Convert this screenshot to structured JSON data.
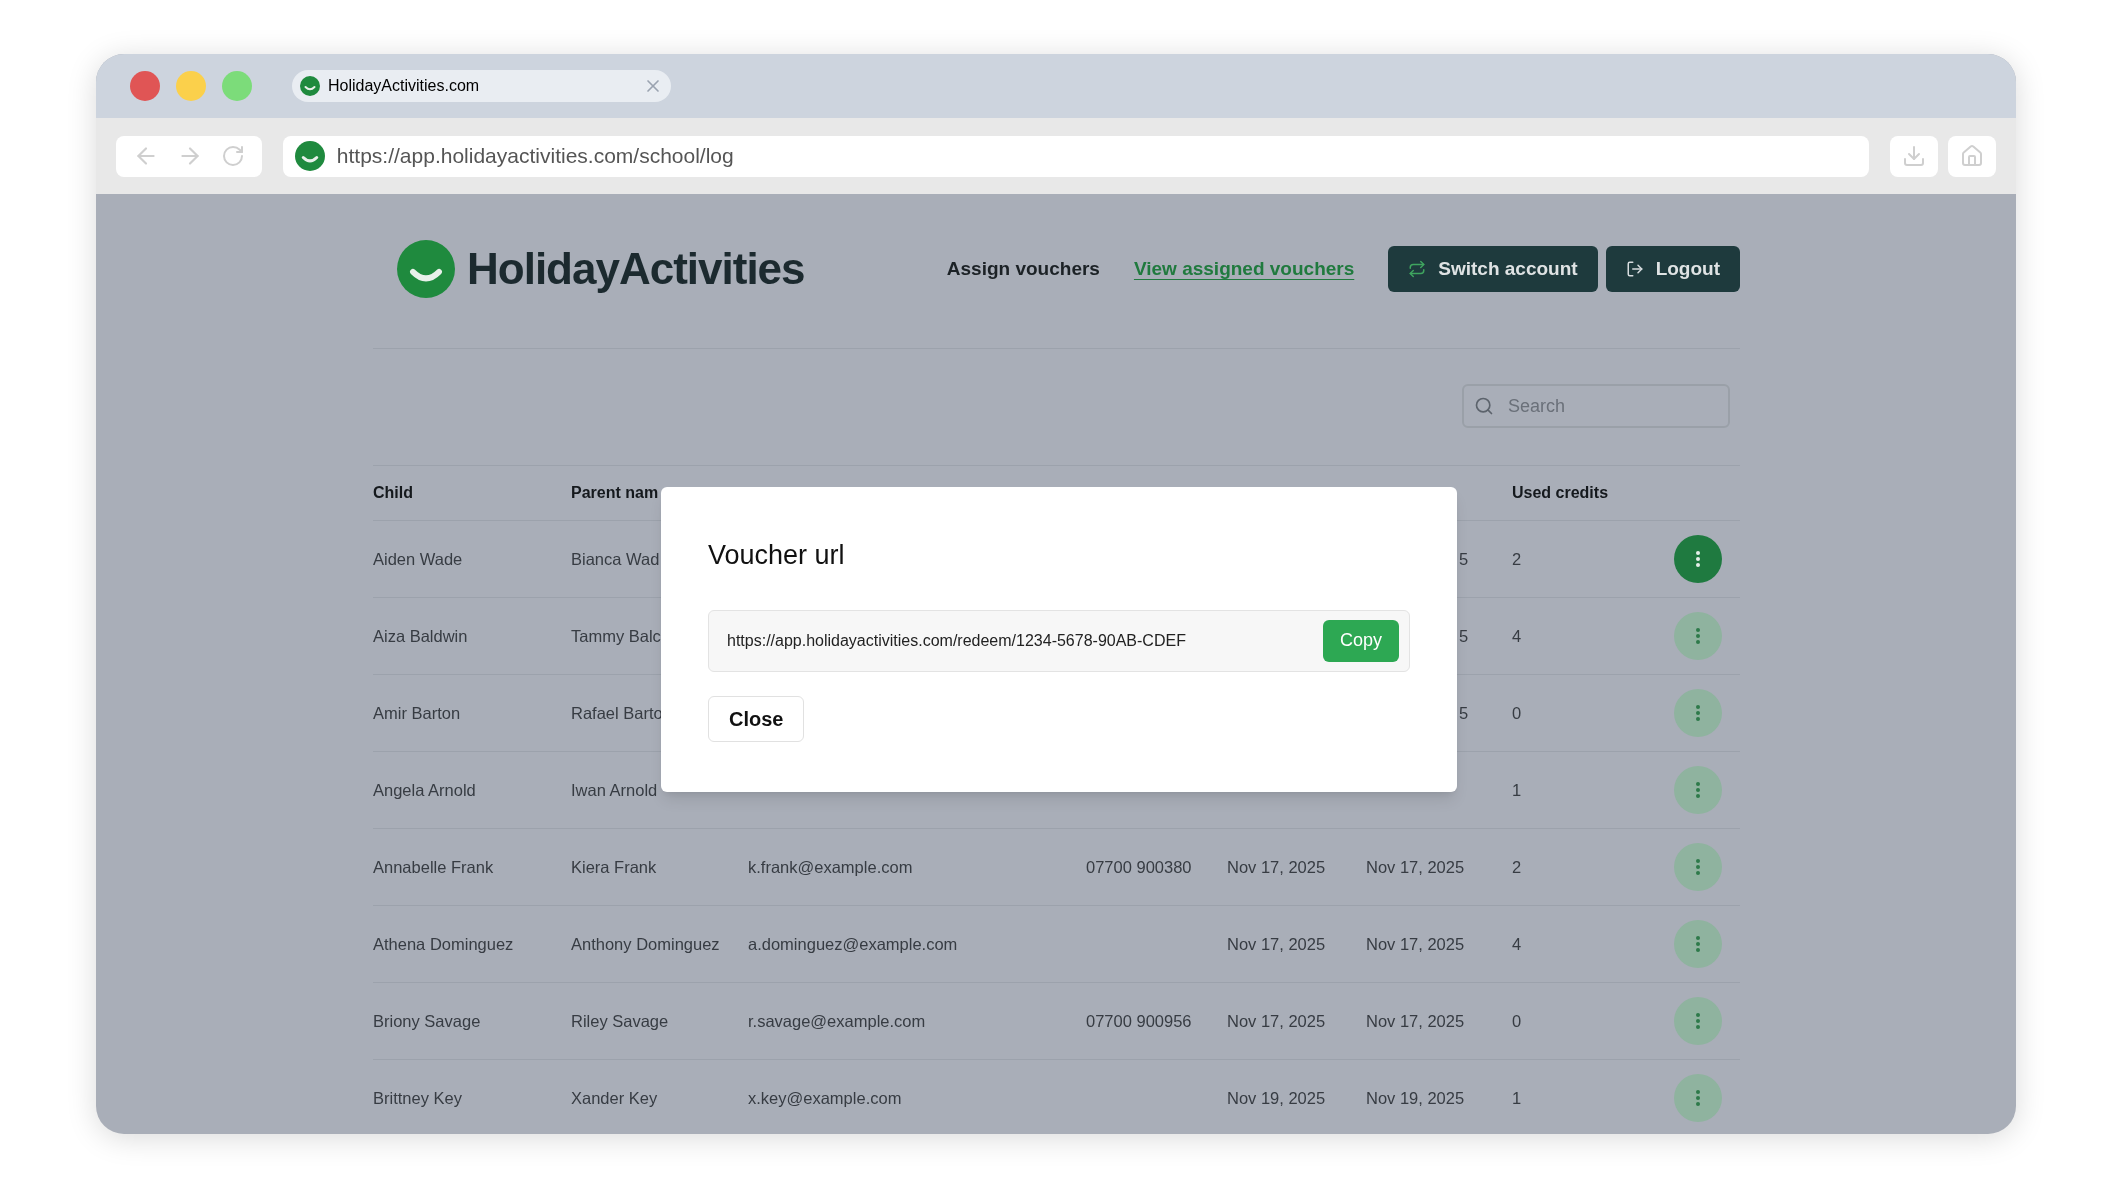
{
  "browser": {
    "tab_title": "HolidayActivities.com",
    "url": "https://app.holidayactivities.com/school/log"
  },
  "header": {
    "logo": "HolidayActivities",
    "nav": [
      {
        "label": "Assign vouchers",
        "selected": false
      },
      {
        "label": "View assigned vouchers",
        "selected": true
      }
    ],
    "buttons": [
      {
        "kind": "switch",
        "label": "Switch account"
      },
      {
        "kind": "logout",
        "label": "Logout"
      }
    ]
  },
  "search": {
    "placeholder": "Search"
  },
  "table": {
    "columns": {
      "child": "Child",
      "parent": "Parent nam",
      "used_credits": "Used credits"
    },
    "rows": [
      {
        "child": "Aiden Wade",
        "parent": "Bianca Wad",
        "column_6": "5",
        "used_credits": "2",
        "selected": true
      },
      {
        "child": "Aiza Baldwin",
        "parent": "Tammy Balc",
        "column_6": "5",
        "used_credits": "4",
        "selected": false
      },
      {
        "child": "Amir Barton",
        "parent": "Rafael Barto",
        "column_6": "5",
        "used_credits": "0",
        "selected": false
      },
      {
        "child": "Angela Arnold",
        "parent": "Iwan Arnold",
        "used_credits": "1",
        "selected": false
      },
      {
        "child": "Annabelle Frank",
        "parent": "Kiera Frank",
        "email": "k.frank@example.com",
        "phone": "07700 900380",
        "column_5": "Nov 17, 2025",
        "column_6": "Nov 17, 2025",
        "used_credits": "2",
        "selected": false
      },
      {
        "child": "Athena Dominguez",
        "parent": "Anthony Dominguez",
        "email": "a.dominguez@example.com",
        "column_5": "Nov 17, 2025",
        "column_6": "Nov 17, 2025",
        "used_credits": "4",
        "selected": false
      },
      {
        "child": "Briony Savage",
        "parent": "Riley Savage",
        "email": "r.savage@example.com",
        "phone": "07700 900956",
        "column_5": "Nov 17, 2025",
        "column_6": "Nov 17, 2025",
        "used_credits": "0",
        "selected": false
      },
      {
        "child": "Brittney Key",
        "parent": "Xander Key",
        "email": "x.key@example.com",
        "column_5": "Nov 19, 2025",
        "column_6": "Nov 19, 2025",
        "used_credits": "1",
        "selected": false
      }
    ]
  },
  "modal": {
    "title": "Voucher url",
    "url": "https://app.holidayactivities.com/redeem/1234-5678-90AB-CDEF",
    "copy_button": "Copy",
    "close_button": "Close"
  }
}
